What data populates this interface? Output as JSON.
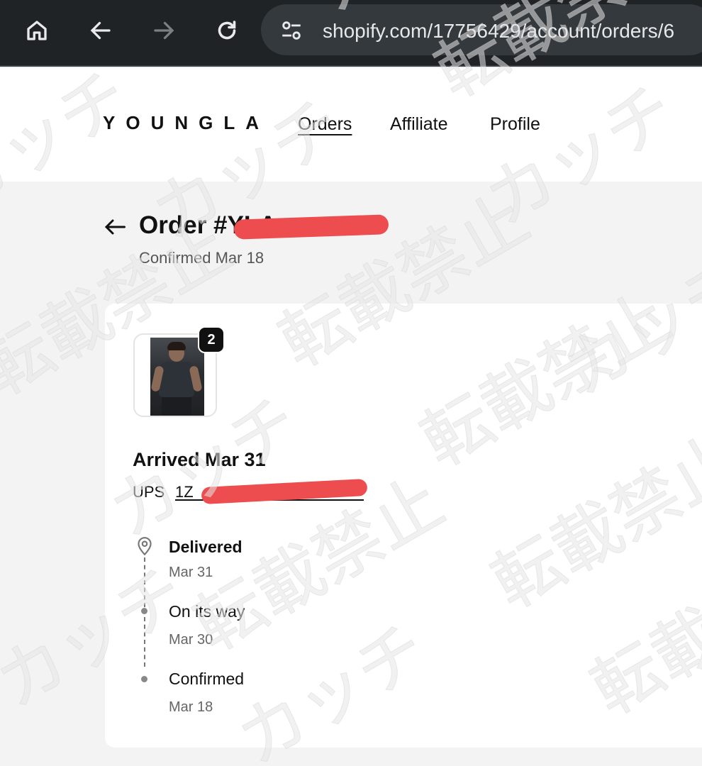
{
  "browser": {
    "url": "shopify.com/17756429/account/orders/6"
  },
  "store": {
    "brand": "YOUNGLA",
    "nav": [
      {
        "label": "Orders",
        "active": true
      },
      {
        "label": "Affiliate",
        "active": false
      },
      {
        "label": "Profile",
        "active": false
      }
    ]
  },
  "order": {
    "title": "Order #YLA",
    "subtitle": "Confirmed Mar 18",
    "item_count": "2",
    "status_heading": "Arrived Mar 31",
    "carrier": "UPS",
    "tracking_number": "1Z"
  },
  "timeline": [
    {
      "label": "Delivered",
      "date": "Mar 31",
      "current": true
    },
    {
      "label": "On its way",
      "date": "Mar 30",
      "current": false
    },
    {
      "label": "Confirmed",
      "date": "Mar 18",
      "current": false
    }
  ],
  "watermark": {
    "words": [
      "転載禁止",
      "カッチ"
    ],
    "color": "#e6e6e6"
  },
  "colors": {
    "redaction": "#ee4d4f",
    "browser_bar": "#1f2326",
    "page_background": "#f3f3f3"
  },
  "icons": [
    "home-icon",
    "back-icon",
    "forward-icon",
    "reload-icon",
    "site-settings-icon",
    "back-arrow-icon",
    "location-pin-icon"
  ]
}
